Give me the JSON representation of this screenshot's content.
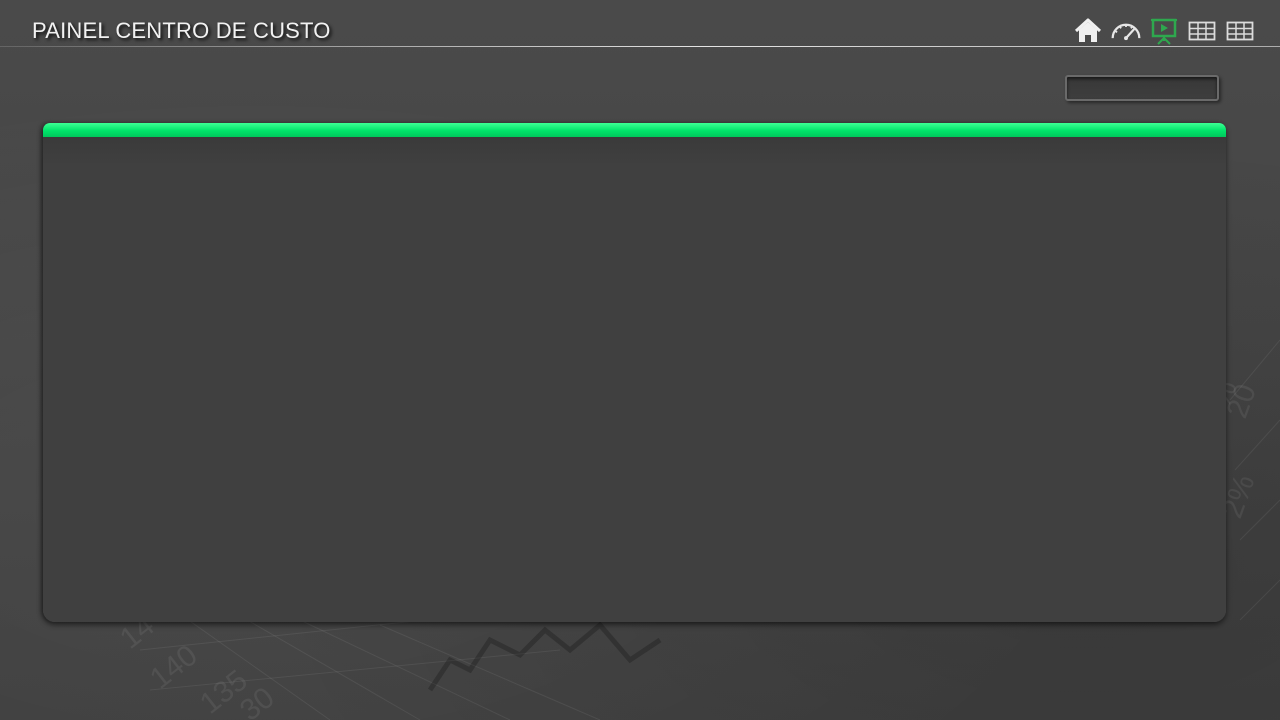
{
  "header": {
    "title": "PAINEL CENTRO DE CUSTO"
  },
  "nav": {
    "items": [
      {
        "icon": "home-icon",
        "active": false
      },
      {
        "icon": "speedometer-icon",
        "active": false
      },
      {
        "icon": "presentation-icon",
        "active": true
      },
      {
        "icon": "table-icon",
        "active": false
      },
      {
        "icon": "table-icon",
        "active": false
      }
    ]
  },
  "colors": {
    "accent": "#00e46a",
    "active_icon": "#2ea84e",
    "icon": "#e6e6e6",
    "background": "#464646",
    "panel": "#404040"
  },
  "filter": {
    "value": ""
  },
  "background_art": {
    "numbers": [
      "140",
      "135",
      "30",
      "14",
      "20",
      "%",
      "2%"
    ]
  }
}
